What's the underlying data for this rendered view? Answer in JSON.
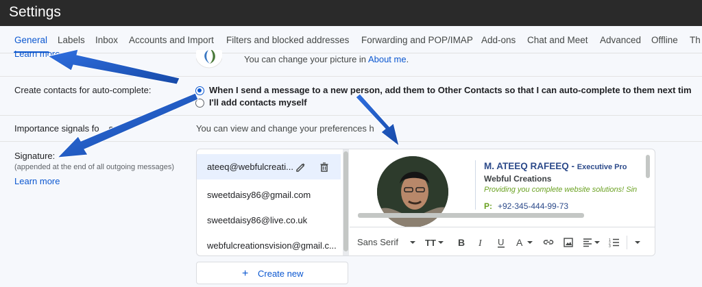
{
  "app": {
    "title": "Settings"
  },
  "tabs": [
    {
      "label": "General",
      "active": true
    },
    {
      "label": "Labels"
    },
    {
      "label": "Inbox"
    },
    {
      "label": "Accounts and Import"
    },
    {
      "label": "Filters and blocked addresses"
    },
    {
      "label": "Forwarding and POP/IMAP"
    },
    {
      "label": "Add-ons"
    },
    {
      "label": "Chat and Meet"
    },
    {
      "label": "Advanced"
    },
    {
      "label": "Offline"
    },
    {
      "label": "Th"
    }
  ],
  "picture": {
    "learn_more": "Learn more",
    "text_before": "You can change your picture in ",
    "link": "About me",
    "text_after": "."
  },
  "contacts": {
    "label": "Create contacts for auto-complete:",
    "option1": "When I send a message to a new person, add them to Other Contacts so that I can auto-complete to them next tim",
    "option2": "I'll add contacts myself"
  },
  "importance": {
    "label": "Importance signals fo",
    "label_rest": "s:",
    "text": "You can view and change your preferences h"
  },
  "signature": {
    "label": "Signature:",
    "sublabel": "(appended at the end of all outgoing messages)",
    "learn_more": "Learn more",
    "items": [
      {
        "label": "ateeq@webfulcreati..."
      },
      {
        "label": "sweetdaisy86@gmail.com"
      },
      {
        "label": "sweetdaisy86@live.co.uk"
      },
      {
        "label": "webfulcreationsvision@gmail.c..."
      }
    ],
    "card": {
      "name": "M. ATEEQ RAFEEQ - ",
      "role": "Executive Pro",
      "company": "Webful Creations",
      "tagline": "Providing you complete website solutions! Sin",
      "phone_label": "P:",
      "phone": "+92-345-444-99-73"
    },
    "toolbar": {
      "font": "Sans Serif"
    },
    "create_new": "Create new"
  },
  "colors": {
    "accent": "#0b57d0",
    "annotation_arrow": "#1f5fc9",
    "topbar": "#2a2a2a"
  }
}
